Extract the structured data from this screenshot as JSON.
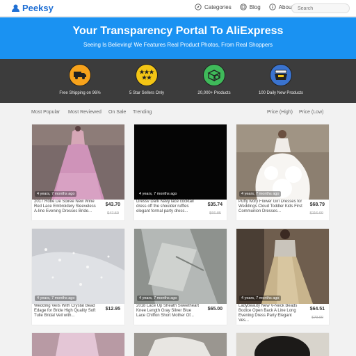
{
  "brand": {
    "name": "Peeksy"
  },
  "nav": {
    "items": [
      {
        "label": "Categories",
        "icon": "compass-icon"
      },
      {
        "label": "Blog",
        "icon": "blog-icon"
      },
      {
        "label": "About",
        "icon": "info-icon"
      }
    ],
    "search_placeholder": "Search"
  },
  "hero": {
    "title": "Your Transparency Portal To AliExpress",
    "subtitle": "Seeing Is Believing! We Features Real Product Photos, From Real Shoppers"
  },
  "features": [
    {
      "label": "Free Shipping on 96%",
      "icon": "truck-icon",
      "color": "#f7a21b"
    },
    {
      "label": "5 Star Sellers Only",
      "icon": "stars-icon",
      "color": "#f3c515"
    },
    {
      "label": "20,000+ Products",
      "icon": "box-icon",
      "color": "#3fba5a"
    },
    {
      "label": "100 Daily New Products",
      "icon": "basket-icon",
      "color": "#3a73cf"
    }
  ],
  "filters": {
    "left": [
      "Most Popular",
      "Most Reviewed",
      "On Sale",
      "Trending"
    ],
    "right": [
      "Price (High)",
      "Price (Low)"
    ]
  },
  "products": [
    {
      "title": "2017 Robe De Soiree New Wine Red Lace Embroidery Sleeveless A-line Evening Dresses Bride...",
      "price": "$43.70",
      "old_price": "$47.50",
      "age": "4 years, 7 months ago"
    },
    {
      "title": "Dressv Dark Navy lace cocktail dress off the shoulder ruffles elegant formal party dress...",
      "price": "$35.74",
      "old_price": "$66.85",
      "age": "4 years, 7 months ago"
    },
    {
      "title": "Puffy Ivory Flower Girl Dresses for Weddings Cloud Toddler Kids First Communion Dresses...",
      "price": "$68.79",
      "old_price": "$116.00",
      "age": "4 years, 7 months ago"
    },
    {
      "title": "Wedding Veils With Crystal Bead Edage for Bride High Quality Soft Tulle Bridal Veil with...",
      "price": "$12.95",
      "old_price": "",
      "age": "4 years, 7 months ago"
    },
    {
      "title": "2018 Lace Up Sheath Sweetheart Knee Length Gray Silver Blue Lace Chiffon Short Mother Of...",
      "price": "$65.00",
      "old_price": "",
      "age": "4 years, 7 months ago"
    },
    {
      "title": "Ladybeauty New V-Neck Beads Bodice Open Back A Line Long Evening Dress Party Elegant Ves...",
      "price": "$64.51",
      "old_price": "$79.00",
      "age": "4 years, 7 months ago"
    }
  ]
}
